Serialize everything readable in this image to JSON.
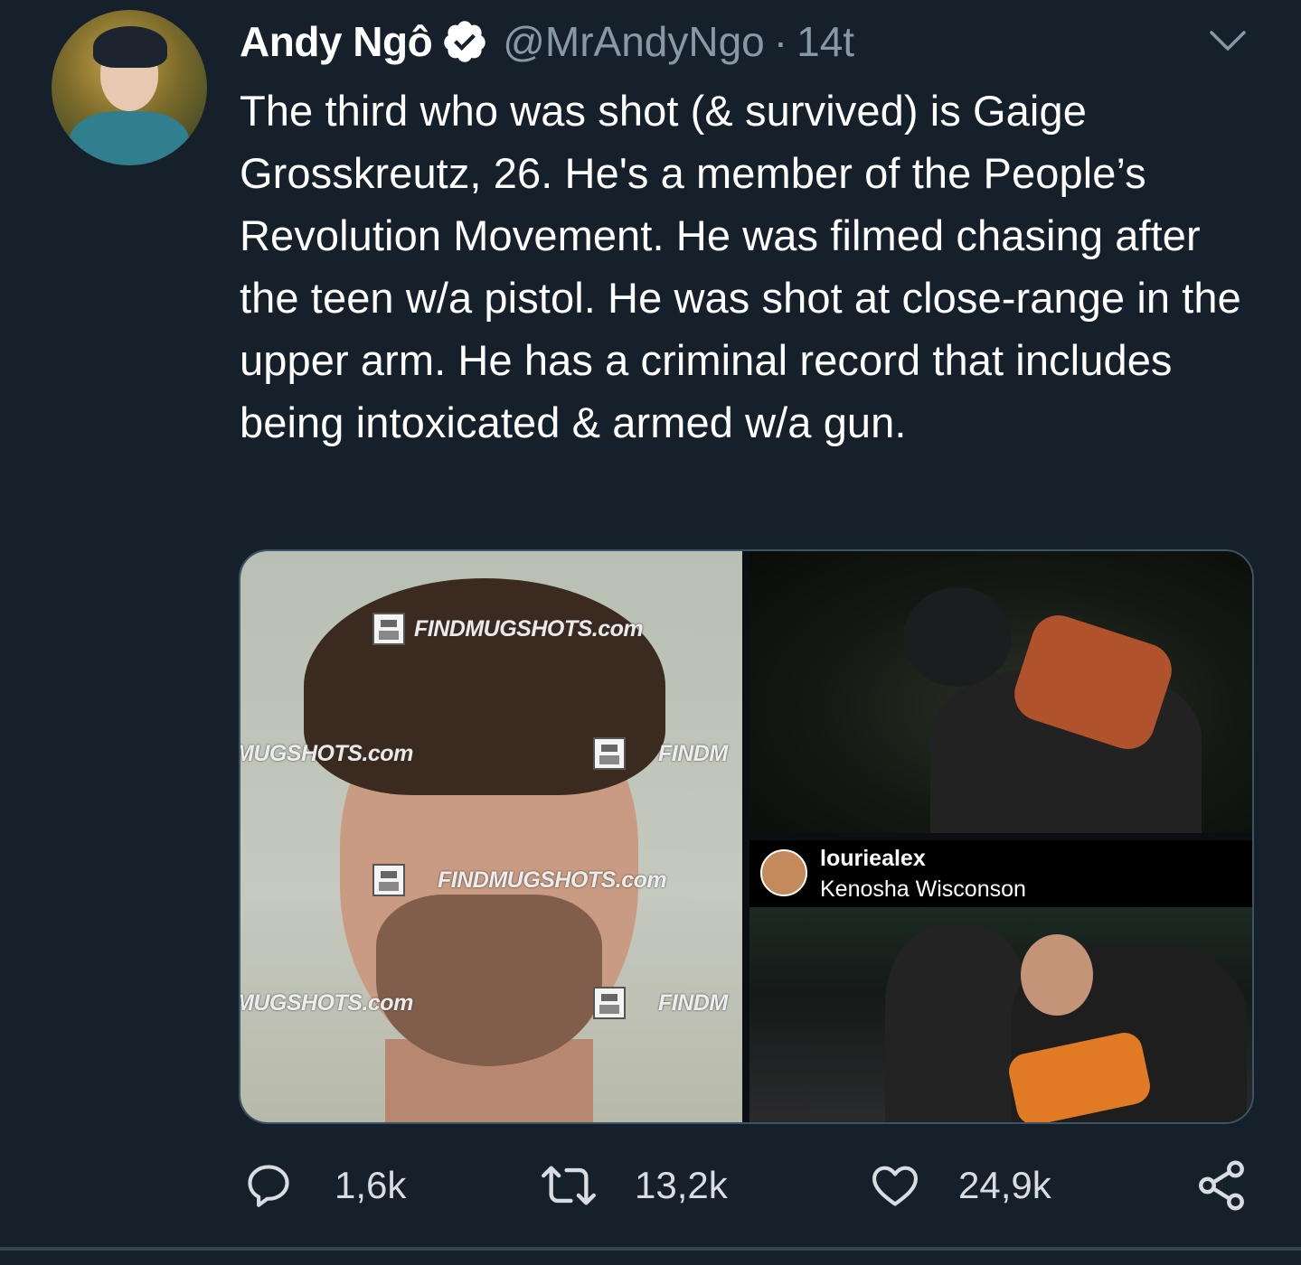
{
  "author": {
    "name": "Andy Ngô",
    "handle": "@MrAndyNgo",
    "separator": "·",
    "time": "14t",
    "verified": true
  },
  "tweet": {
    "text": "The third who was shot (& survived) is Gaige Grosskreutz, 26. He's a member of the People’s Revolution Movement. He was filmed chasing after the teen w/a pistol. He was shot at close-range in the upper arm. He has a criminal record that includes being intoxicated & armed w/a gun."
  },
  "media": {
    "watermarks": {
      "top": "FINDMUGSHOTS.com",
      "mid_left": "MUGSHOTS.com",
      "mid_right": "FINDM",
      "center": "FINDMUGSHOTS.com",
      "low_left": "MUGSHOTS.com",
      "low_right": "FINDM"
    },
    "instagram": {
      "username": "louriealex",
      "location": "Kenosha Wisconson"
    }
  },
  "actions": {
    "replies": "1,6k",
    "retweets": "13,2k",
    "likes": "24,9k"
  },
  "icons": [
    "verified-badge-icon",
    "chevron-down-icon",
    "reply-icon",
    "retweet-icon",
    "like-icon",
    "share-icon"
  ],
  "colors": {
    "background": "#15202b",
    "secondary_text": "#8899a6",
    "border": "#38444d"
  }
}
